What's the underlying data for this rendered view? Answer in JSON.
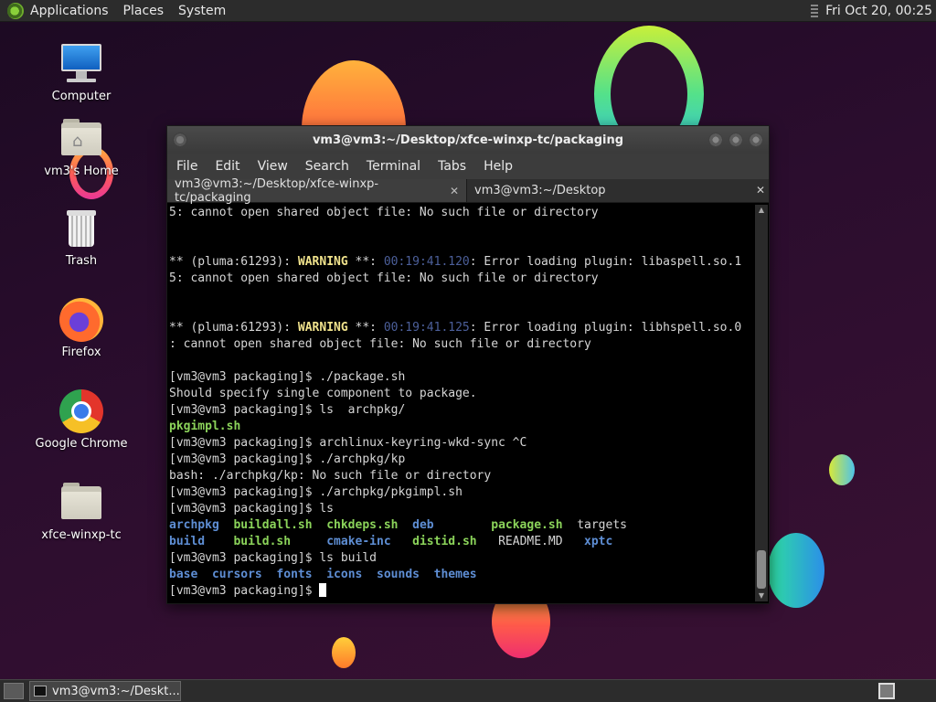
{
  "top_panel": {
    "menus": [
      "Applications",
      "Places",
      "System"
    ],
    "clock": "Fri Oct 20, 00:25"
  },
  "desktop_icons": [
    {
      "label": "Computer"
    },
    {
      "label": "vm3's Home"
    },
    {
      "label": "Trash"
    },
    {
      "label": "Firefox"
    },
    {
      "label": "Google Chrome"
    },
    {
      "label": "xfce-winxp-tc"
    }
  ],
  "terminal": {
    "title": "vm3@vm3:~/Desktop/xfce-winxp-tc/packaging",
    "menu": [
      "File",
      "Edit",
      "View",
      "Search",
      "Terminal",
      "Tabs",
      "Help"
    ],
    "tabs": [
      {
        "label": "vm3@vm3:~/Desktop/xfce-winxp-tc/packaging"
      },
      {
        "label": "vm3@vm3:~/Desktop"
      }
    ],
    "output": {
      "l1": "5: cannot open shared object file: No such file or directory",
      "w1_a": "** (pluma:61293): ",
      "w1_b": "WARNING",
      "w1_c": " **: ",
      "w1_ts": "00:19:41.120",
      "w1_d": ": Error loading plugin: libaspell.so.1",
      "l2": "5: cannot open shared object file: No such file or directory",
      "w2_a": "** (pluma:61293): ",
      "w2_b": "WARNING",
      "w2_c": " **: ",
      "w2_ts": "00:19:41.125",
      "w2_d": ": Error loading plugin: libhspell.so.0",
      "l3": ": cannot open shared object file: No such file or directory",
      "p1": "[vm3@vm3 packaging]$ ./package.sh",
      "o1": "Should specify single component to package.",
      "p2": "[vm3@vm3 packaging]$ ls  archpkg/",
      "o2": "pkgimpl.sh",
      "p3": "[vm3@vm3 packaging]$ archlinux-keyring-wkd-sync ^C",
      "p4": "[vm3@vm3 packaging]$ ./archpkg/kp",
      "o3": "bash: ./archpkg/kp: No such file or directory",
      "p5": "[vm3@vm3 packaging]$ ./archpkg/pkgimpl.sh",
      "p6": "[vm3@vm3 packaging]$ ls",
      "ls_row1": [
        "archpkg",
        "buildall.sh",
        "chkdeps.sh",
        "deb",
        "package.sh",
        "targets"
      ],
      "ls_row2": [
        "build",
        "build.sh",
        "cmake-inc",
        "distid.sh",
        "README.MD",
        "xptc"
      ],
      "p7": "[vm3@vm3 packaging]$ ls build",
      "ls_build": [
        "base",
        "cursors",
        "fonts",
        "icons",
        "sounds",
        "themes"
      ],
      "prompt": "[vm3@vm3 packaging]$ "
    }
  },
  "taskbar": {
    "task_label": "vm3@vm3:~/Deskt..."
  },
  "colors": {
    "warning": "#f0e28c",
    "timestamp": "#4c5f9a",
    "executable": "#8bd35a",
    "directory": "#5e8ed4"
  }
}
